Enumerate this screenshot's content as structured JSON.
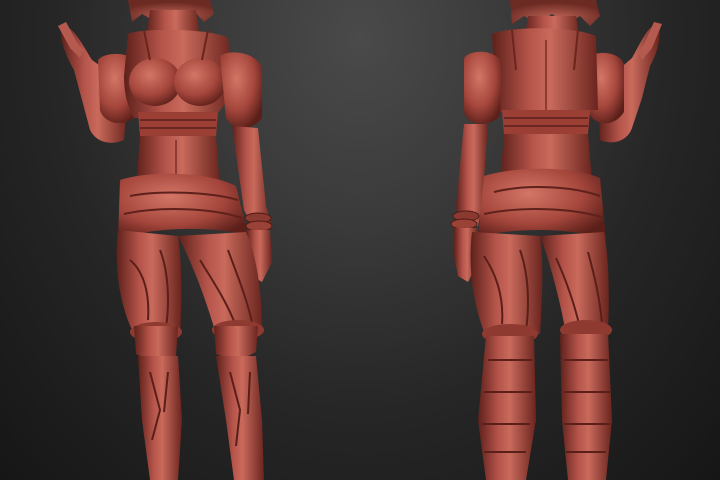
{
  "scene": {
    "background_top": "#4a4a4a",
    "background_bottom": "#161616",
    "material_base": "#a8483e",
    "material_highlight": "#cd6d5f",
    "material_shadow": "#4e1a15",
    "views": [
      {
        "view": "front"
      },
      {
        "view": "back"
      }
    ]
  }
}
